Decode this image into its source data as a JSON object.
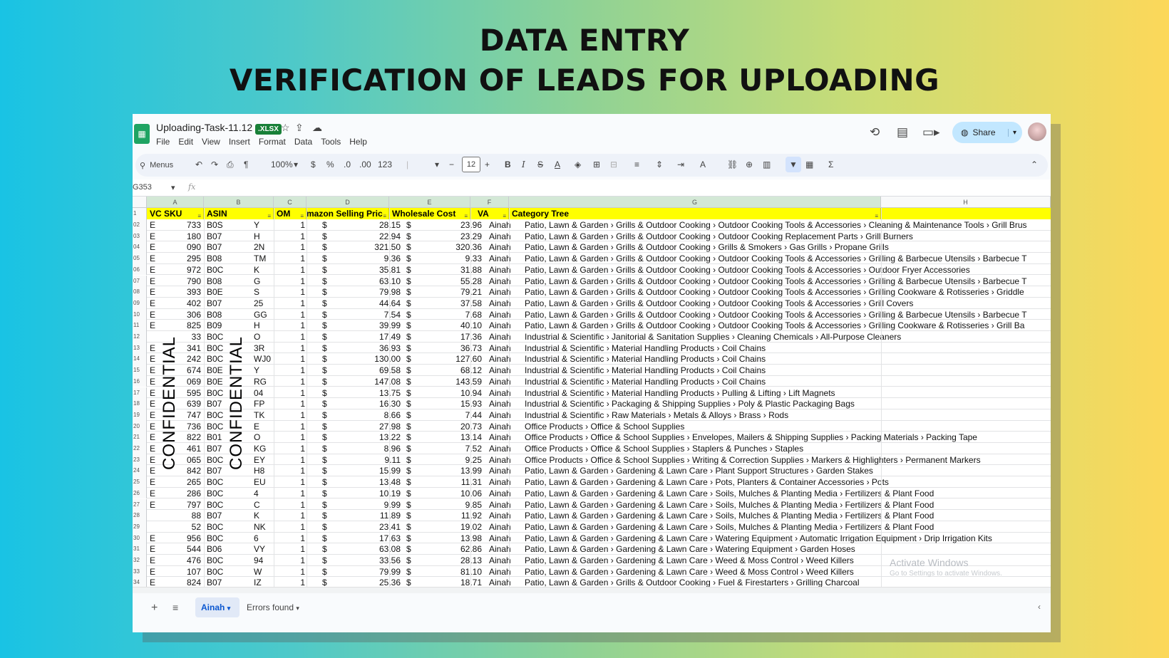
{
  "headline": {
    "line1": "DATA ENTRY",
    "line2": "VERIFICATION OF LEADS FOR UPLOADING"
  },
  "app": {
    "title": "Uploading-Task-11.12",
    "badge": ".XLSX",
    "menu": [
      "File",
      "Edit",
      "View",
      "Insert",
      "Format",
      "Data",
      "Tools",
      "Help"
    ],
    "share_label": "Share",
    "accent_color": "#c2e7ff",
    "brand_color": "#1fa463"
  },
  "toolbar": {
    "search_label": "Menus",
    "zoom": "100%",
    "currency": "$",
    "percent": "%",
    "dec_minus": ".0",
    "dec_plus": ".00",
    "number_format": "123",
    "font_size": "12",
    "bold": "B",
    "italic": "I"
  },
  "formula_bar": {
    "namebox": "G353",
    "fx": "fx"
  },
  "columns": [
    "A",
    "B",
    "C",
    "D",
    "E",
    "F",
    "G",
    "H"
  ],
  "header_row": {
    "row_num": "1",
    "cells": [
      "VC SKU",
      "ASIN",
      "OM",
      "mazon Selling Pric",
      "Wholesale Cost",
      "VA",
      "Category Tree"
    ]
  },
  "watermark_text": "CONFIDENTIAL",
  "rows": [
    {
      "n": "02",
      "a1": "E",
      "a2": "733",
      "b1": "B0S",
      "b2": "Y",
      "c": "1",
      "d": "28.15",
      "e": "23.96",
      "f": "Ainah",
      "g": "Patio, Lawn & Garden › Grills & Outdoor Cooking › Outdoor Cooking Tools & Accessories › Cleaning & Maintenance Tools › Grill Brus"
    },
    {
      "n": "03",
      "a1": "E",
      "a2": "180",
      "b1": "B07",
      "b2": "H",
      "c": "1",
      "d": "22.94",
      "e": "23.29",
      "f": "Ainah",
      "g": "Patio, Lawn & Garden › Grills & Outdoor Cooking › Outdoor Cooking Replacement Parts › Grill Burners"
    },
    {
      "n": "04",
      "a1": "E",
      "a2": "090",
      "b1": "B07",
      "b2": "2N",
      "c": "1",
      "d": "321.50",
      "e": "320.36",
      "f": "Ainah",
      "g": "Patio, Lawn & Garden › Grills & Outdoor Cooking › Grills & Smokers › Gas Grills › Propane Grills"
    },
    {
      "n": "05",
      "a1": "E",
      "a2": "295",
      "b1": "B08",
      "b2": "TM",
      "c": "1",
      "d": "9.36",
      "e": "9.33",
      "f": "Ainah",
      "g": "Patio, Lawn & Garden › Grills & Outdoor Cooking › Outdoor Cooking Tools & Accessories › Grilling & Barbecue Utensils › Barbecue T"
    },
    {
      "n": "06",
      "a1": "E",
      "a2": "972",
      "b1": "B0C",
      "b2": "K",
      "c": "1",
      "d": "35.81",
      "e": "31.88",
      "f": "Ainah",
      "g": "Patio, Lawn & Garden › Grills & Outdoor Cooking › Outdoor Cooking Tools & Accessories › Outdoor Fryer Accessories"
    },
    {
      "n": "07",
      "a1": "E",
      "a2": "790",
      "b1": "B08",
      "b2": "G",
      "c": "1",
      "d": "63.10",
      "e": "55.28",
      "f": "Ainah",
      "g": "Patio, Lawn & Garden › Grills & Outdoor Cooking › Outdoor Cooking Tools & Accessories › Grilling & Barbecue Utensils › Barbecue T"
    },
    {
      "n": "08",
      "a1": "E",
      "a2": "393",
      "b1": "B0E",
      "b2": "S",
      "c": "1",
      "d": "79.98",
      "e": "79.21",
      "f": "Ainah",
      "g": "Patio, Lawn & Garden › Grills & Outdoor Cooking › Outdoor Cooking Tools & Accessories › Grilling Cookware & Rotisseries › Griddle"
    },
    {
      "n": "09",
      "a1": "E",
      "a2": "402",
      "b1": "B07",
      "b2": "25",
      "c": "1",
      "d": "44.64",
      "e": "37.58",
      "f": "Ainah",
      "g": "Patio, Lawn & Garden › Grills & Outdoor Cooking › Outdoor Cooking Tools & Accessories › Grill Covers"
    },
    {
      "n": "10",
      "a1": "E",
      "a2": "306",
      "b1": "B08",
      "b2": "GG",
      "c": "1",
      "d": "7.54",
      "e": "7.68",
      "f": "Ainah",
      "g": "Patio, Lawn & Garden › Grills & Outdoor Cooking › Outdoor Cooking Tools & Accessories › Grilling & Barbecue Utensils › Barbecue T"
    },
    {
      "n": "11",
      "a1": "E",
      "a2": "825",
      "b1": "B09",
      "b2": "H",
      "c": "1",
      "d": "39.99",
      "e": "40.10",
      "f": "Ainah",
      "g": "Patio, Lawn & Garden › Grills & Outdoor Cooking › Outdoor Cooking Tools & Accessories › Grilling Cookware & Rotisseries › Grill Ba"
    },
    {
      "n": "12",
      "a1": "",
      "a2": "33",
      "b1": "B0C",
      "b2": "O",
      "c": "1",
      "d": "17.49",
      "e": "17.36",
      "f": "Ainah",
      "g": "Industrial & Scientific › Janitorial & Sanitation Supplies › Cleaning Chemicals › All-Purpose Cleaners"
    },
    {
      "n": "13",
      "a1": "E",
      "a2": "341",
      "b1": "B0C",
      "b2": "3R",
      "c": "1",
      "d": "36.93",
      "e": "36.73",
      "f": "Ainah",
      "g": "Industrial & Scientific › Material Handling Products › Coil Chains"
    },
    {
      "n": "14",
      "a1": "E",
      "a2": "242",
      "b1": "B0C",
      "b2": "WJ0",
      "c": "1",
      "d": "130.00",
      "e": "127.60",
      "f": "Ainah",
      "g": "Industrial & Scientific › Material Handling Products › Coil Chains"
    },
    {
      "n": "15",
      "a1": "E",
      "a2": "674",
      "b1": "B0E",
      "b2": "Y",
      "c": "1",
      "d": "69.58",
      "e": "68.12",
      "f": "Ainah",
      "g": "Industrial & Scientific › Material Handling Products › Coil Chains"
    },
    {
      "n": "16",
      "a1": "E",
      "a2": "069",
      "b1": "B0E",
      "b2": "RG",
      "c": "1",
      "d": "147.08",
      "e": "143.59",
      "f": "Ainah",
      "g": "Industrial & Scientific › Material Handling Products › Coil Chains"
    },
    {
      "n": "17",
      "a1": "E",
      "a2": "595",
      "b1": "B0C",
      "b2": "04",
      "c": "1",
      "d": "13.75",
      "e": "10.94",
      "f": "Ainah",
      "g": "Industrial & Scientific › Material Handling Products › Pulling & Lifting › Lift Magnets"
    },
    {
      "n": "18",
      "a1": "E",
      "a2": "639",
      "b1": "B07",
      "b2": "FP",
      "c": "1",
      "d": "16.30",
      "e": "15.93",
      "f": "Ainah",
      "g": "Industrial & Scientific › Packaging & Shipping Supplies › Poly & Plastic Packaging Bags"
    },
    {
      "n": "19",
      "a1": "E",
      "a2": "747",
      "b1": "B0C",
      "b2": "TK",
      "c": "1",
      "d": "8.66",
      "e": "7.44",
      "f": "Ainah",
      "g": "Industrial & Scientific › Raw Materials › Metals & Alloys › Brass › Rods"
    },
    {
      "n": "20",
      "a1": "E",
      "a2": "736",
      "b1": "B0C",
      "b2": "E",
      "c": "1",
      "d": "27.98",
      "e": "20.73",
      "f": "Ainah",
      "g": "Office Products › Office & School Supplies"
    },
    {
      "n": "21",
      "a1": "E",
      "a2": "822",
      "b1": "B01",
      "b2": "O",
      "c": "1",
      "d": "13.22",
      "e": "13.14",
      "f": "Ainah",
      "g": "Office Products › Office & School Supplies › Envelopes, Mailers & Shipping Supplies › Packing Materials › Packing Tape"
    },
    {
      "n": "22",
      "a1": "E",
      "a2": "461",
      "b1": "B07",
      "b2": "KG",
      "c": "1",
      "d": "8.96",
      "e": "7.52",
      "f": "Ainah",
      "g": "Office Products › Office & School Supplies › Staplers & Punches › Staples"
    },
    {
      "n": "23",
      "a1": "E",
      "a2": "065",
      "b1": "B0C",
      "b2": "EY",
      "c": "1",
      "d": "9.11",
      "e": "9.25",
      "f": "Ainah",
      "g": "Office Products › Office & School Supplies › Writing & Correction Supplies › Markers & Highlighters › Permanent Markers"
    },
    {
      "n": "24",
      "a1": "E",
      "a2": "842",
      "b1": "B07",
      "b2": "H8",
      "c": "1",
      "d": "15.99",
      "e": "13.99",
      "f": "Ainah",
      "g": "Patio, Lawn & Garden › Gardening & Lawn Care › Plant Support Structures › Garden Stakes"
    },
    {
      "n": "25",
      "a1": "E",
      "a2": "265",
      "b1": "B0C",
      "b2": "EU",
      "c": "1",
      "d": "13.48",
      "e": "11.31",
      "f": "Ainah",
      "g": "Patio, Lawn & Garden › Gardening & Lawn Care › Pots, Planters & Container Accessories › Pots"
    },
    {
      "n": "26",
      "a1": "E",
      "a2": "286",
      "b1": "B0C",
      "b2": "4",
      "c": "1",
      "d": "10.19",
      "e": "10.06",
      "f": "Ainah",
      "g": "Patio, Lawn & Garden › Gardening & Lawn Care › Soils, Mulches & Planting Media › Fertilizers & Plant Food"
    },
    {
      "n": "27",
      "a1": "E",
      "a2": "797",
      "b1": "B0C",
      "b2": "C",
      "c": "1",
      "d": "9.99",
      "e": "9.85",
      "f": "Ainah",
      "g": "Patio, Lawn & Garden › Gardening & Lawn Care › Soils, Mulches & Planting Media › Fertilizers & Plant Food"
    },
    {
      "n": "28",
      "a1": "",
      "a2": "88",
      "b1": "B07",
      "b2": "K",
      "c": "1",
      "d": "11.89",
      "e": "11.92",
      "f": "Ainah",
      "g": "Patio, Lawn & Garden › Gardening & Lawn Care › Soils, Mulches & Planting Media › Fertilizers & Plant Food"
    },
    {
      "n": "29",
      "a1": "",
      "a2": "52",
      "b1": "B0C",
      "b2": "NK",
      "c": "1",
      "d": "23.41",
      "e": "19.02",
      "f": "Ainah",
      "g": "Patio, Lawn & Garden › Gardening & Lawn Care › Soils, Mulches & Planting Media › Fertilizers & Plant Food"
    },
    {
      "n": "30",
      "a1": "E",
      "a2": "956",
      "b1": "B0C",
      "b2": "6",
      "c": "1",
      "d": "17.63",
      "e": "13.98",
      "f": "Ainah",
      "g": "Patio, Lawn & Garden › Gardening & Lawn Care › Watering Equipment › Automatic Irrigation Equipment › Drip Irrigation Kits"
    },
    {
      "n": "31",
      "a1": "E",
      "a2": "544",
      "b1": "B06",
      "b2": "VY",
      "c": "1",
      "d": "63.08",
      "e": "62.86",
      "f": "Ainah",
      "g": "Patio, Lawn & Garden › Gardening & Lawn Care › Watering Equipment › Garden Hoses"
    },
    {
      "n": "32",
      "a1": "E",
      "a2": "476",
      "b1": "B0C",
      "b2": "94",
      "c": "1",
      "d": "33.56",
      "e": "28.13",
      "f": "Ainah",
      "g": "Patio, Lawn & Garden › Gardening & Lawn Care › Weed & Moss Control › Weed Killers"
    },
    {
      "n": "33",
      "a1": "E",
      "a2": "107",
      "b1": "B0C",
      "b2": "W",
      "c": "1",
      "d": "79.99",
      "e": "81.10",
      "f": "Ainah",
      "g": "Patio, Lawn & Garden › Gardening & Lawn Care › Weed & Moss Control › Weed Killers"
    },
    {
      "n": "34",
      "a1": "E",
      "a2": "824",
      "b1": "B07",
      "b2": "IZ",
      "c": "1",
      "d": "25.36",
      "e": "18.71",
      "f": "Ainah",
      "g": "Patio, Lawn & Garden › Grills & Outdoor Cooking › Fuel & Firestarters › Grilling Charcoal"
    }
  ],
  "windows_watermark": {
    "line1": "Activate Windows",
    "line2": "Go to Settings to activate Windows."
  },
  "sheet_tabs": {
    "active": "Ainah",
    "other": "Errors found"
  }
}
